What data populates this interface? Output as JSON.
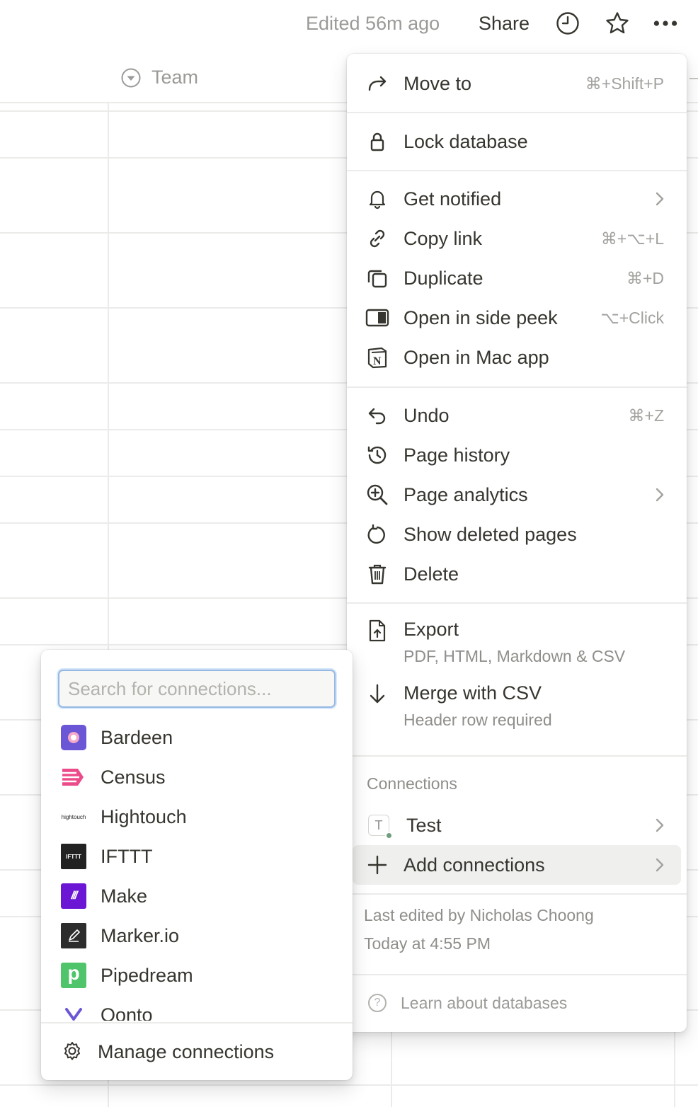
{
  "topbar": {
    "edited": "Edited 56m ago",
    "share": "Share",
    "icons": [
      "clock-icon",
      "star-icon",
      "more-icon"
    ]
  },
  "table": {
    "column_header": "Team",
    "column_icon": "select-property-icon"
  },
  "menu": {
    "move_to": {
      "label": "Move to",
      "shortcut": "⌘+Shift+P"
    },
    "lock": {
      "label": "Lock database"
    },
    "get_notified": {
      "label": "Get notified"
    },
    "copy_link": {
      "label": "Copy link",
      "shortcut": "⌘+⌥+L"
    },
    "duplicate": {
      "label": "Duplicate",
      "shortcut": "⌘+D"
    },
    "side_peek": {
      "label": "Open in side peek",
      "shortcut": "⌥+Click"
    },
    "mac_app": {
      "label": "Open in Mac app"
    },
    "undo": {
      "label": "Undo",
      "shortcut": "⌘+Z"
    },
    "page_history": {
      "label": "Page history"
    },
    "page_analytics": {
      "label": "Page analytics"
    },
    "show_deleted": {
      "label": "Show deleted pages"
    },
    "delete": {
      "label": "Delete"
    },
    "export": {
      "label": "Export",
      "sub": "PDF, HTML, Markdown & CSV"
    },
    "merge": {
      "label": "Merge with CSV",
      "sub": "Header row required"
    },
    "connections_title": "Connections",
    "test": {
      "badge": "T",
      "label": "Test"
    },
    "add_connections": {
      "label": "Add connections"
    },
    "last_edited_by": "Last edited by Nicholas Choong",
    "last_edited_time": "Today at 4:55 PM",
    "learn": "Learn about databases"
  },
  "connections_menu": {
    "search_placeholder": "Search for connections...",
    "search_value": "",
    "items": [
      {
        "label": "Bardeen",
        "logo": "bardeen-logo",
        "color": "#6b57d6"
      },
      {
        "label": "Census",
        "logo": "census-logo",
        "color": "#ec4b8a"
      },
      {
        "label": "Hightouch",
        "logo": "hightouch-logo",
        "logo_text": "hightouch",
        "color": "#1f1f1f"
      },
      {
        "label": "IFTTT",
        "logo": "ifttt-logo",
        "logo_text": "IFTTT",
        "color": "#222222"
      },
      {
        "label": "Make",
        "logo": "make-logo",
        "logo_text": "///",
        "color": "#6a16d4"
      },
      {
        "label": "Marker.io",
        "logo": "markerio-logo",
        "color": "#2d2d2d"
      },
      {
        "label": "Pipedream",
        "logo": "pipedream-logo",
        "logo_text": "p",
        "color": "#4fc46b"
      },
      {
        "label": "Qonto",
        "logo": "qonto-logo",
        "color": "#6b57d6"
      }
    ],
    "manage": "Manage connections"
  }
}
